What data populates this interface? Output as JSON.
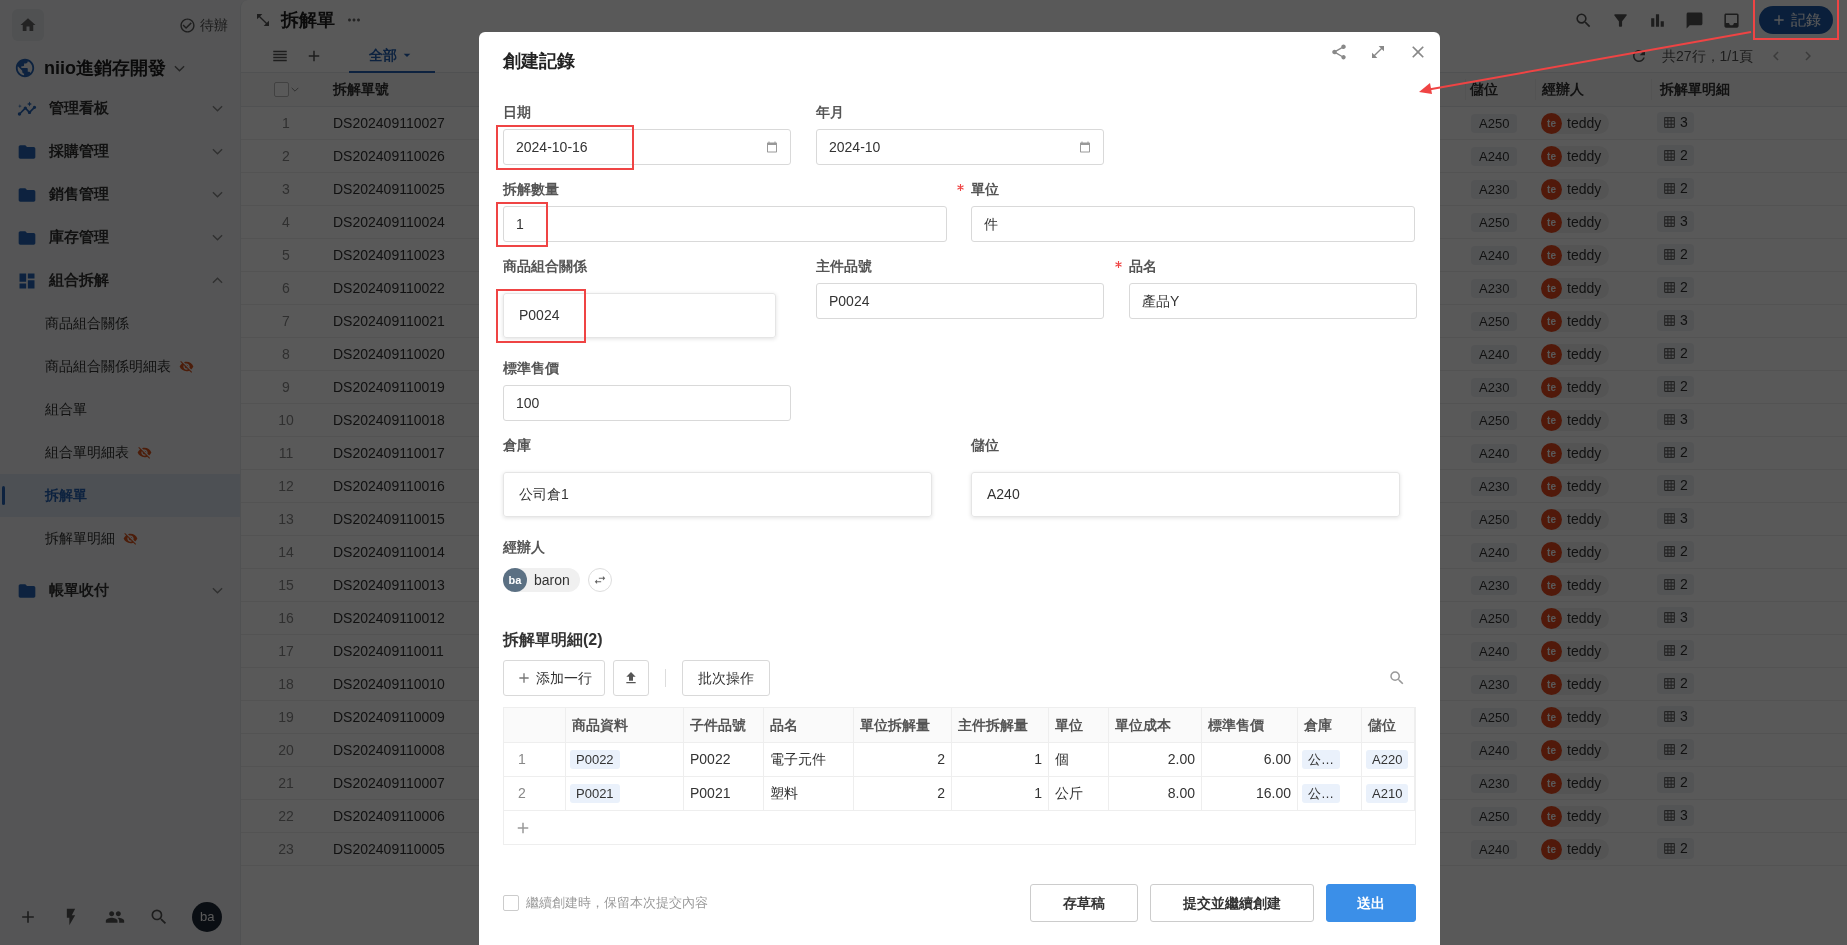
{
  "sidebar": {
    "todo": "待辦",
    "workspace": "niio進銷存開發",
    "items": [
      {
        "label": "管理看板",
        "expanded": false
      },
      {
        "label": "採購管理",
        "expanded": false
      },
      {
        "label": "銷售管理",
        "expanded": false
      },
      {
        "label": "庫存管理",
        "expanded": false
      },
      {
        "label": "組合拆解",
        "expanded": true,
        "children": [
          {
            "label": "商品組合關係",
            "hidden": false,
            "selected": false
          },
          {
            "label": "商品組合關係明細表",
            "hidden": true,
            "selected": false
          },
          {
            "label": "組合單",
            "hidden": false,
            "selected": false
          },
          {
            "label": "組合單明細表",
            "hidden": true,
            "selected": false
          },
          {
            "label": "拆解單",
            "hidden": false,
            "selected": true
          },
          {
            "label": "拆解單明細",
            "hidden": true,
            "selected": false
          }
        ]
      },
      {
        "label": "帳單收付",
        "expanded": false
      }
    ],
    "user_initials": "ba"
  },
  "header": {
    "title": "拆解單",
    "add_button": "記錄",
    "add_button_highlighted": true
  },
  "view_tabs": [
    {
      "label": "全部",
      "selected": true
    }
  ],
  "pagination": "共27行，1/1頁",
  "table": {
    "select_all": {
      "checked": false
    },
    "columns": [
      "拆解單號",
      "儲位",
      "經辦人",
      "拆解單明細"
    ],
    "rows": [
      {
        "no": "1",
        "code": "DS202409110027",
        "bin": "A250",
        "initials": "te",
        "handler": "teddy",
        "details": "3"
      },
      {
        "no": "2",
        "code": "DS202409110026",
        "bin": "A240",
        "initials": "te",
        "handler": "teddy",
        "details": "2"
      },
      {
        "no": "3",
        "code": "DS202409110025",
        "bin": "A230",
        "initials": "te",
        "handler": "teddy",
        "details": "2"
      },
      {
        "no": "4",
        "code": "DS202409110024",
        "bin": "A250",
        "initials": "te",
        "handler": "teddy",
        "details": "3"
      },
      {
        "no": "5",
        "code": "DS202409110023",
        "bin": "A240",
        "initials": "te",
        "handler": "teddy",
        "details": "2"
      },
      {
        "no": "6",
        "code": "DS202409110022",
        "bin": "A230",
        "initials": "te",
        "handler": "teddy",
        "details": "2"
      },
      {
        "no": "7",
        "code": "DS202409110021",
        "bin": "A250",
        "initials": "te",
        "handler": "teddy",
        "details": "3"
      },
      {
        "no": "8",
        "code": "DS202409110020",
        "bin": "A240",
        "initials": "te",
        "handler": "teddy",
        "details": "2"
      },
      {
        "no": "9",
        "code": "DS202409110019",
        "bin": "A230",
        "initials": "te",
        "handler": "teddy",
        "details": "2"
      },
      {
        "no": "10",
        "code": "DS202409110018",
        "bin": "A250",
        "initials": "te",
        "handler": "teddy",
        "details": "3"
      },
      {
        "no": "11",
        "code": "DS202409110017",
        "bin": "A240",
        "initials": "te",
        "handler": "teddy",
        "details": "2"
      },
      {
        "no": "12",
        "code": "DS202409110016",
        "bin": "A230",
        "initials": "te",
        "handler": "teddy",
        "details": "2"
      },
      {
        "no": "13",
        "code": "DS202409110015",
        "bin": "A250",
        "initials": "te",
        "handler": "teddy",
        "details": "3"
      },
      {
        "no": "14",
        "code": "DS202409110014",
        "bin": "A240",
        "initials": "te",
        "handler": "teddy",
        "details": "2"
      },
      {
        "no": "15",
        "code": "DS202409110013",
        "bin": "A230",
        "initials": "te",
        "handler": "teddy",
        "details": "2"
      },
      {
        "no": "16",
        "code": "DS202409110012",
        "bin": "A250",
        "initials": "te",
        "handler": "teddy",
        "details": "3"
      },
      {
        "no": "17",
        "code": "DS202409110011",
        "bin": "A240",
        "initials": "te",
        "handler": "teddy",
        "details": "2"
      },
      {
        "no": "18",
        "code": "DS202409110010",
        "bin": "A230",
        "initials": "te",
        "handler": "teddy",
        "details": "2"
      },
      {
        "no": "19",
        "code": "DS202409110009",
        "bin": "A250",
        "initials": "te",
        "handler": "teddy",
        "details": "3"
      },
      {
        "no": "20",
        "code": "DS202409110008",
        "bin": "A240",
        "initials": "te",
        "handler": "teddy",
        "details": "2"
      },
      {
        "no": "21",
        "code": "DS202409110007",
        "bin": "A230",
        "initials": "te",
        "handler": "teddy",
        "details": "2"
      },
      {
        "no": "22",
        "code": "DS202409110006",
        "bin": "A250",
        "initials": "te",
        "handler": "teddy",
        "details": "3"
      },
      {
        "no": "23",
        "code": "DS202409110005",
        "bin": "A240",
        "initials": "te",
        "handler": "teddy",
        "details": "2"
      }
    ]
  },
  "modal": {
    "title": "創建記錄",
    "rows": [
      {
        "kind": "thirds",
        "fields": [
          {
            "label": "日期",
            "value": "2024-10-16",
            "kind": "date",
            "required": false,
            "highlighted": true
          },
          {
            "label": "年月",
            "value": "2024-10",
            "kind": "date",
            "required": false,
            "highlighted": false
          }
        ]
      },
      {
        "kind": "halves",
        "fields": [
          {
            "label": "拆解數量",
            "value": "1",
            "kind": "text",
            "required": false,
            "highlighted": true
          },
          {
            "label": "單位",
            "value": "件",
            "kind": "text",
            "required": true,
            "highlighted": false
          }
        ]
      },
      {
        "kind": "thirds",
        "fields": [
          {
            "label": "商品組合關係",
            "value": "P0024",
            "kind": "picker",
            "required": false,
            "highlighted": true
          },
          {
            "label": "主件品號",
            "value": "P0024",
            "kind": "text",
            "required": false,
            "highlighted": false
          },
          {
            "label": "品名",
            "value": "產品Y",
            "kind": "text",
            "required": true,
            "highlighted": false
          }
        ]
      },
      {
        "kind": "thirds",
        "fields": [
          {
            "label": "標準售價",
            "value": "100",
            "kind": "text",
            "required": false,
            "highlighted": false
          }
        ]
      },
      {
        "kind": "halves",
        "fields": [
          {
            "label": "倉庫",
            "value": "公司倉1",
            "kind": "picker",
            "required": false,
            "highlighted": false
          },
          {
            "label": "儲位",
            "value": "A240",
            "kind": "picker",
            "required": false,
            "highlighted": false
          }
        ]
      }
    ],
    "handler": {
      "label": "經辦人",
      "initials": "ba",
      "name": "baron"
    },
    "details": {
      "title": "拆解單明細(2)",
      "add_row": "添加一行",
      "batch": "批次操作",
      "columns": [
        "",
        "商品資料",
        "子件品號",
        "品名",
        "單位拆解量",
        "主件拆解量",
        "單位",
        "單位成本",
        "標準售價",
        "倉庫",
        "儲位"
      ],
      "rows": [
        [
          "1",
          "P0022",
          "P0022",
          "電子元件",
          "2",
          "1",
          "個",
          "2.00",
          "6.00",
          "公…",
          "A220"
        ],
        [
          "2",
          "P0021",
          "P0021",
          "塑料",
          "2",
          "1",
          "公斤",
          "8.00",
          "16.00",
          "公…",
          "A210"
        ]
      ]
    },
    "keep_content": {
      "label": "繼續創建時，保留本次提交內容",
      "checked": false
    },
    "buttons": [
      {
        "label": "存草稿",
        "kind": "secondary"
      },
      {
        "label": "提交並繼續創建",
        "kind": "secondary"
      },
      {
        "label": "送出",
        "kind": "primary"
      }
    ]
  }
}
